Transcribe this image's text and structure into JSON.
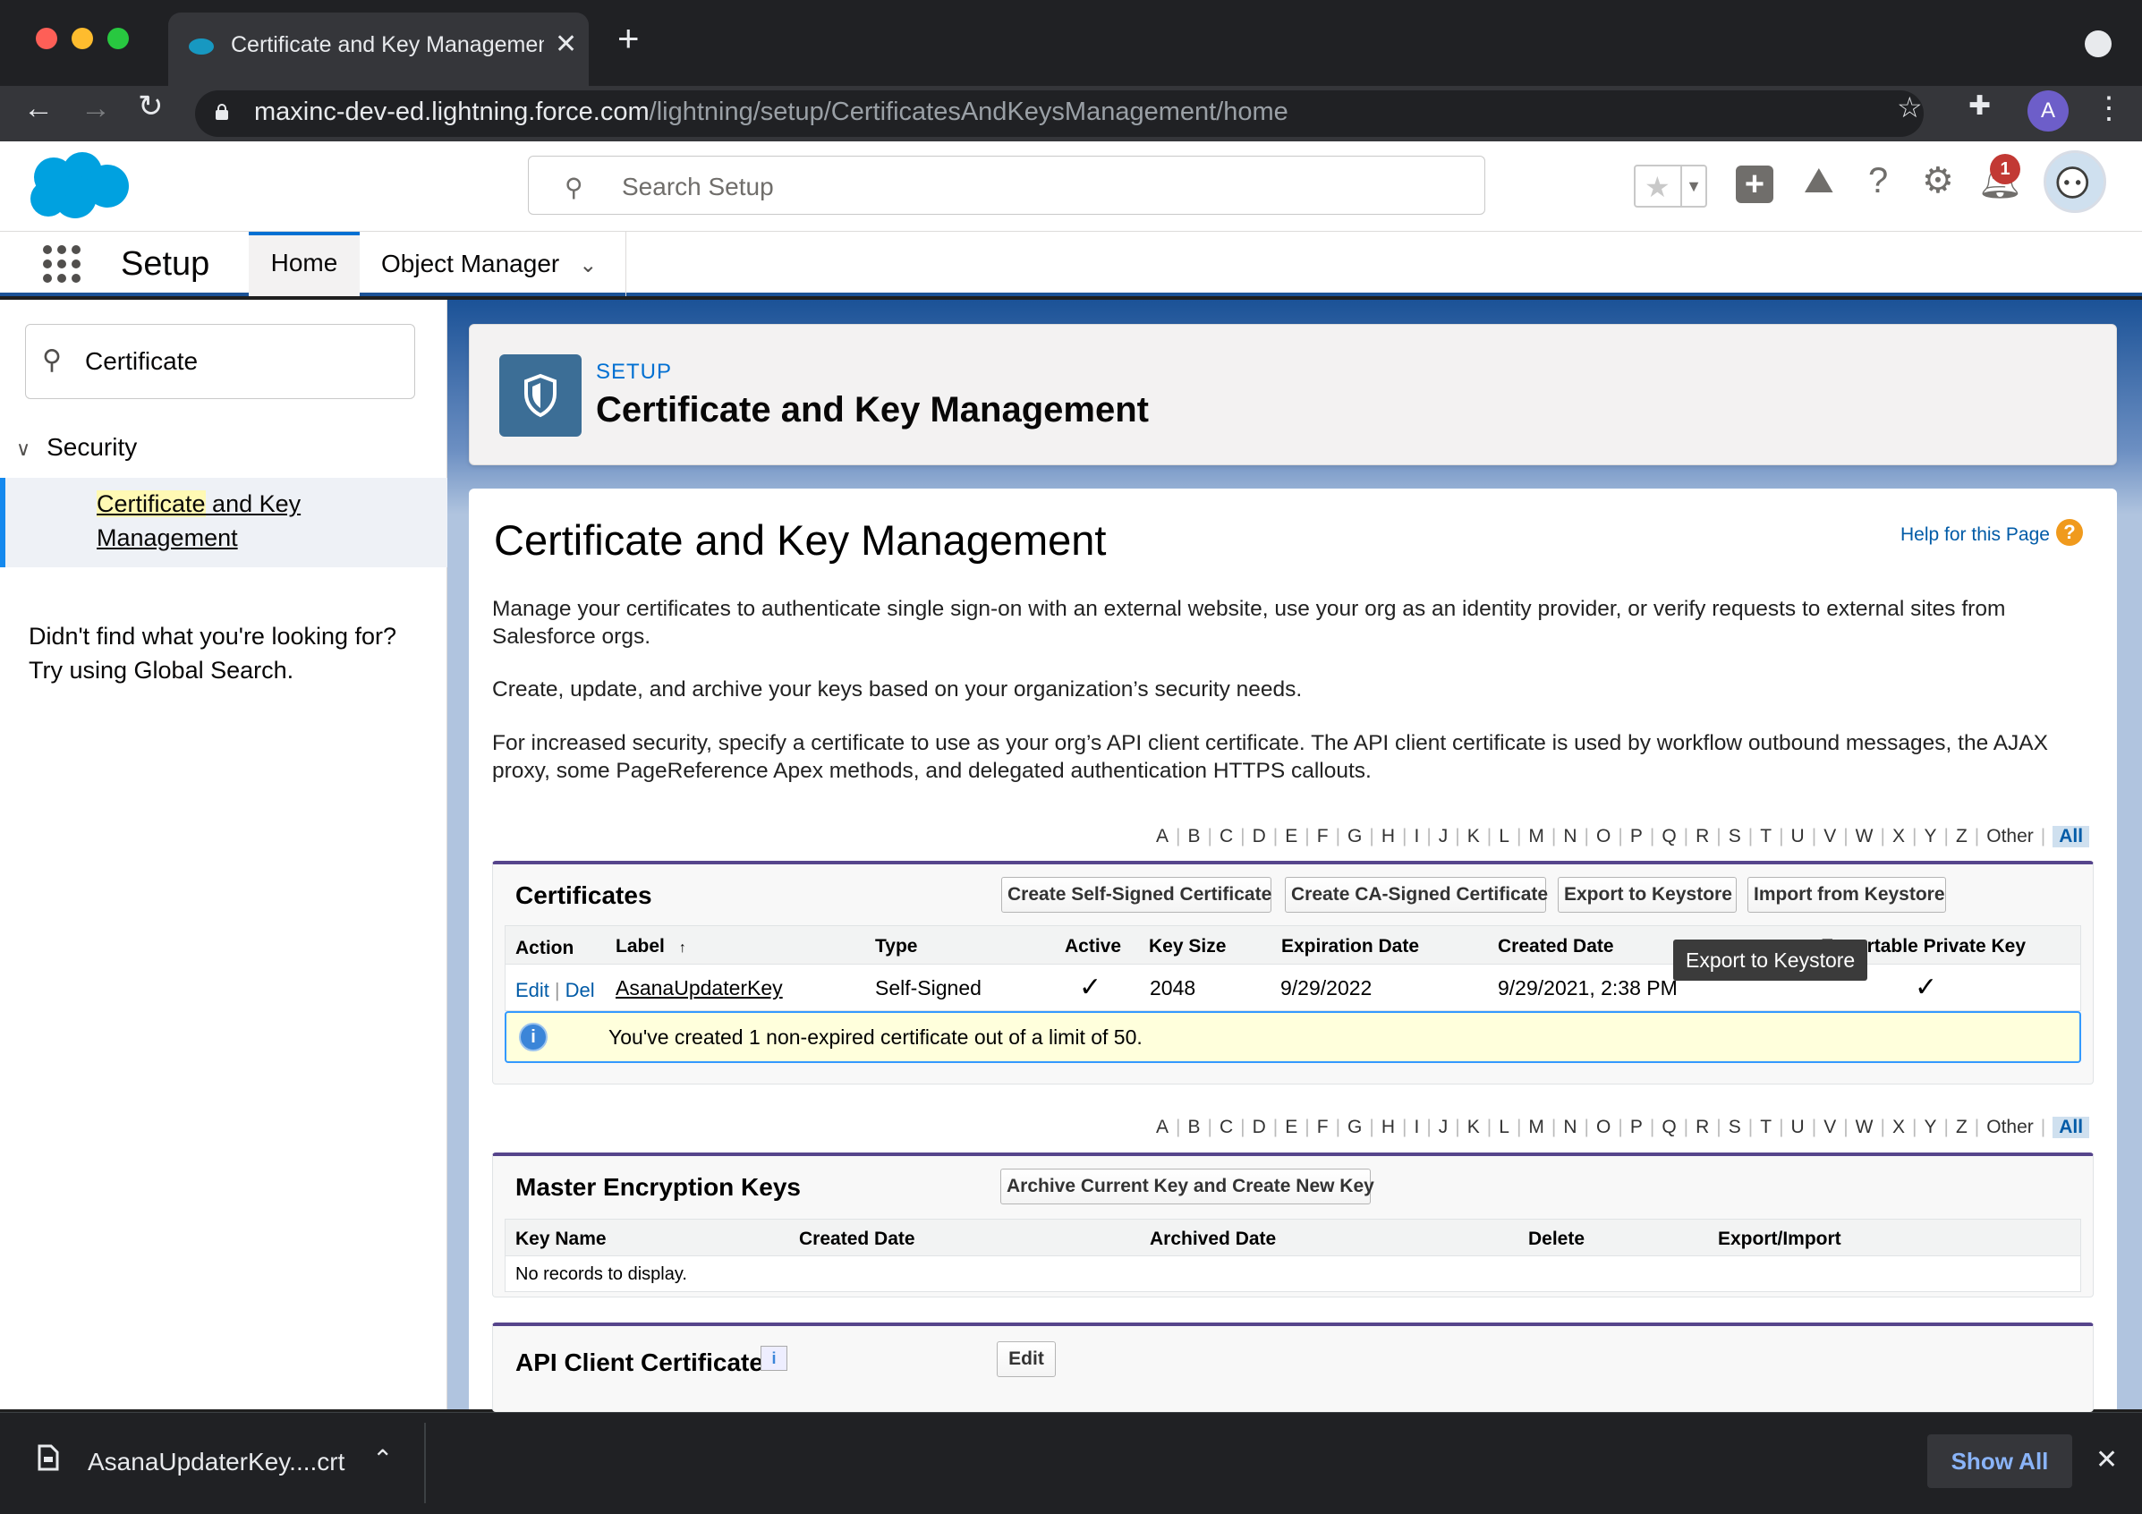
{
  "browser": {
    "tab_title": "Certificate and Key Management",
    "tab_close": "✕",
    "new_tab": "+",
    "url_domain": "maxinc-dev-ed.lightning.force.com",
    "url_path": "/lightning/setup/CertificatesAndKeysManagement/home",
    "profile_initial": "A"
  },
  "header": {
    "search_placeholder": "Search Setup",
    "notification_count": "1"
  },
  "nav": {
    "app_name": "Setup",
    "tabs": [
      {
        "label": "Home"
      },
      {
        "label": "Object Manager"
      }
    ]
  },
  "sidebar": {
    "quick_find_value": "Certificate",
    "group_label": "Security",
    "item_highlight": "Certificate",
    "item_rest": " and Key",
    "item_line2": "Management",
    "not_found_line1": "Didn't find what you're looking for?",
    "not_found_line2": "Try using Global Search."
  },
  "page_header": {
    "eyebrow": "SETUP",
    "title": "Certificate and Key Management"
  },
  "main": {
    "title": "Certificate and Key Management",
    "help_link": "Help for this Page",
    "help_icon": "?",
    "para1": "Manage your certificates to authenticate single sign-on with an external website, use your org as an identity provider, or verify requests to external sites from Salesforce orgs.",
    "para2": "Create, update, and archive your keys based on your organization’s security needs.",
    "para3": "For increased security, specify a certificate to use as your org’s API client certificate. The API client certificate is used by workflow outbound messages, the AJAX proxy, some PageReference Apex methods, and delegated authentication HTTPS callouts."
  },
  "alphabet": [
    "A",
    "B",
    "C",
    "D",
    "E",
    "F",
    "G",
    "H",
    "I",
    "J",
    "K",
    "L",
    "M",
    "N",
    "O",
    "P",
    "Q",
    "R",
    "S",
    "T",
    "U",
    "V",
    "W",
    "X",
    "Y",
    "Z",
    "Other",
    "All"
  ],
  "certificates": {
    "title": "Certificates",
    "buttons": [
      "Create Self-Signed Certificate",
      "Create CA-Signed Certificate",
      "Export to Keystore",
      "Import from Keystore"
    ],
    "columns": [
      "Action",
      "Label",
      "Type",
      "Active",
      "Key Size",
      "Expiration Date",
      "Created Date",
      "Exportable Private Key"
    ],
    "row": {
      "edit": "Edit",
      "sep": "|",
      "del": "Del",
      "label": "AsanaUpdaterKey",
      "type": "Self-Signed",
      "active": "✓",
      "key_size": "2048",
      "expiration": "9/29/2022",
      "created": "9/29/2021, 2:38 PM",
      "exportable": "✓"
    },
    "info_icon": "i",
    "info": "You've created 1 non-expired certificate out of a limit of 50.",
    "tooltip": "Export to Keystore",
    "sort_arrow": "↑"
  },
  "master_keys": {
    "title": "Master Encryption Keys",
    "button": "Archive Current Key and Create New Key",
    "columns": [
      "Key Name",
      "Created Date",
      "Archived Date",
      "Delete",
      "Export/Import"
    ],
    "empty": "No records to display."
  },
  "api_client": {
    "title": "API Client Certificate",
    "info_icon": "i",
    "button": "Edit"
  },
  "downloads": {
    "file": "AsanaUpdaterKey....crt",
    "show_all": "Show All"
  },
  "colors": {
    "brand_blue": "#1b5297",
    "link": "#015ba7",
    "pb_accent": "#56458c",
    "info_bg": "#ffffdc"
  }
}
